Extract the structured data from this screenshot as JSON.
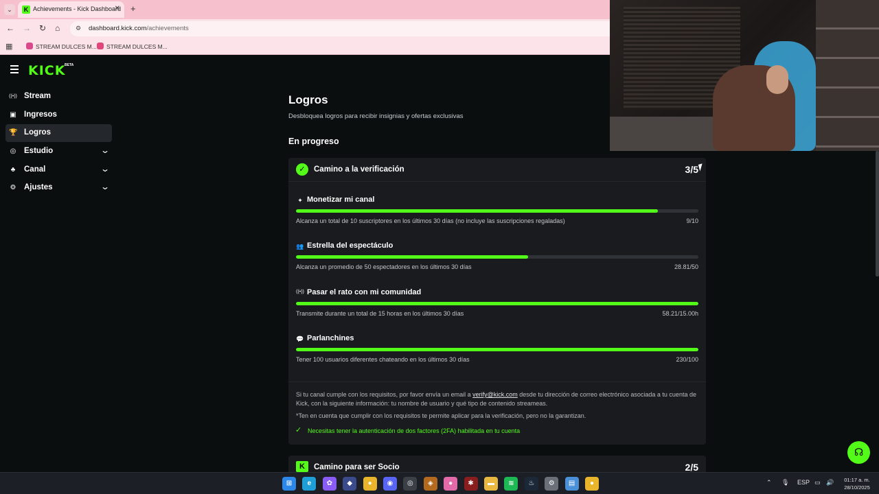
{
  "browser": {
    "tab_menu_icon": "chevron-down-icon",
    "tab_title": "Achievements - Kick Dashboard",
    "tab_close": "✕",
    "new_tab": "+",
    "url_domain": "dashboard.kick.com",
    "url_path": "/achievements",
    "bookmarks": [
      {
        "label": "STREAM DULCES M...",
        "color": "#d94a8c"
      },
      {
        "label": "STREAM DULCES M...",
        "color": "#e0457b"
      }
    ]
  },
  "kick": {
    "logo": "KICK",
    "beta": "BETA",
    "brand_color": "#53fc18"
  },
  "sidebar": {
    "items": [
      {
        "label": "Stream",
        "icon": "broadcast-icon",
        "glyph": "((•))",
        "active": false,
        "expandable": false
      },
      {
        "label": "Ingresos",
        "icon": "wallet-icon",
        "glyph": "▣",
        "active": false,
        "expandable": false
      },
      {
        "label": "Logros",
        "icon": "trophy-icon",
        "glyph": "🏆",
        "active": true,
        "expandable": false
      },
      {
        "label": "Estudio",
        "icon": "studio-icon",
        "glyph": "◎",
        "active": false,
        "expandable": true
      },
      {
        "label": "Canal",
        "icon": "channel-icon",
        "glyph": "♣",
        "active": false,
        "expandable": true
      },
      {
        "label": "Ajustes",
        "icon": "gear-icon",
        "glyph": "⚙",
        "active": false,
        "expandable": true
      }
    ],
    "chevron": "⌄"
  },
  "main": {
    "title": "Logros",
    "subtitle": "Desbloquea logros para recibir insignias y ofertas exclusivas",
    "section_title": "En progreso",
    "verification": {
      "title": "Camino a la verificación",
      "progress": "3/5",
      "tasks": [
        {
          "title": "Monetizar mi canal",
          "glyph": "✦",
          "icon": "sparkle-icon",
          "desc": "Alcanza un total de 10 suscriptores en los últimos 30 días (no incluye las suscripciones regaladas)",
          "value": "9/10",
          "fraction": 0.9
        },
        {
          "title": "Estrella del espectáculo",
          "glyph": "👥",
          "icon": "viewers-icon",
          "desc": "Alcanza un promedio de 50 espectadores en los últimos 30 días",
          "value": "28.81/50",
          "fraction": 0.576
        },
        {
          "title": "Pasar el rato con mi comunidad",
          "glyph": "((•))",
          "icon": "broadcast-icon",
          "desc": "Transmite durante un total de 15 horas en los últimos 30 días",
          "value": "58.21/15.00h",
          "fraction": 1.0
        },
        {
          "title": "Parlanchines",
          "glyph": "💬",
          "icon": "chat-icon",
          "desc": "Tener 100 usuarios diferentes chateando en los últimos 30 días",
          "value": "230/100",
          "fraction": 1.0
        }
      ],
      "info_before": "Si tu canal cumple con los requisitos, por favor envía un email a ",
      "info_email": "verify@kick.com",
      "info_after": " desde tu dirección de correo electrónico asociada a tu cuenta de Kick, con la siguiente información: tu nombre de usuario y qué tipo de contenido streameas.",
      "disclaimer": "*Ten en cuenta que cumplir con los requisitos te permite aplicar para la verificación, pero no la garantizan.",
      "requirement": "Necesitas tener la autenticación de dos factores (2FA) habilitada en tu cuenta"
    },
    "partner": {
      "title": "Camino para ser Socio",
      "progress": "2/5"
    }
  },
  "taskbar": {
    "apps": [
      {
        "name": "windows-start-icon",
        "color": "#2b88e8",
        "glyph": "⊞"
      },
      {
        "name": "edge-icon",
        "color": "#1e9fd8",
        "glyph": "e"
      },
      {
        "name": "copilot-icon",
        "color": "#8a5cf6",
        "glyph": "✿"
      },
      {
        "name": "app-diamond-icon",
        "color": "#3a4a8a",
        "glyph": "◆"
      },
      {
        "name": "chrome-icon",
        "color": "#e8b52b",
        "glyph": "●"
      },
      {
        "name": "discord-icon",
        "color": "#5865f2",
        "glyph": "◉"
      },
      {
        "name": "obs-icon",
        "color": "#3b3f46",
        "glyph": "◎"
      },
      {
        "name": "app-shield-icon",
        "color": "#b36a1e",
        "glyph": "◈"
      },
      {
        "name": "app-pink-icon",
        "color": "#e26aa8",
        "glyph": "●"
      },
      {
        "name": "app-red-icon",
        "color": "#8a1e1e",
        "glyph": "✱"
      },
      {
        "name": "file-explorer-icon",
        "color": "#e8b840",
        "glyph": "▬"
      },
      {
        "name": "spotify-icon",
        "color": "#1db954",
        "glyph": "≋"
      },
      {
        "name": "steam-icon",
        "color": "#1b2838",
        "glyph": "♨"
      },
      {
        "name": "settings-icon",
        "color": "#6a6f78",
        "glyph": "⚙"
      },
      {
        "name": "notepad-icon",
        "color": "#4a90d9",
        "glyph": "▤"
      },
      {
        "name": "chrome-active-icon",
        "color": "#e8b52b",
        "glyph": "●"
      }
    ],
    "language": "ESP",
    "time": "01:17 a. m.",
    "date": "28/10/2025"
  }
}
